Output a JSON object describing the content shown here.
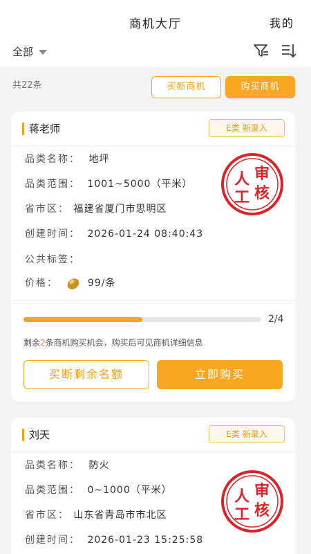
{
  "header": {
    "title": "商机大厅",
    "mine": "我的",
    "filter": "全部"
  },
  "toolbar": {
    "count": "共22条",
    "buyout_btn": "买断商机",
    "buy_btn": "购买商机"
  },
  "labels": {
    "category": "品类名称：",
    "range": "品类范围：",
    "region": "省市区：",
    "created": "创建时间：",
    "tags": "公共标签：",
    "price": "价格："
  },
  "seal": {
    "line1": "人",
    "line2": "审",
    "line3": "工",
    "line4": "核",
    "color": "#d9242a"
  },
  "accent": "#f9a623",
  "cards": [
    {
      "name": "蒋老师",
      "badge": "E类  新录入",
      "category": "地坪",
      "range": "1001~5000（平米）",
      "region": "福建省厦门市思明区",
      "created": "2026-01-24  08:40:43",
      "tags": "",
      "price": "99/条",
      "progress_text": "2/4",
      "progress_fraction": 0.5,
      "remain_prefix": "剩余",
      "remain_count": "2",
      "remain_suffix": "条商机购买机会，购买后可见商机详细信息",
      "buyout_rest": "买断剩余名额",
      "buy_now": "立即购买"
    },
    {
      "name": "刘天",
      "badge": "E类  新录入",
      "category": "防火",
      "range": "0~1000（平米）",
      "region": "山东省青岛市市北区",
      "created": "2026-01-23  15:25:58"
    }
  ]
}
